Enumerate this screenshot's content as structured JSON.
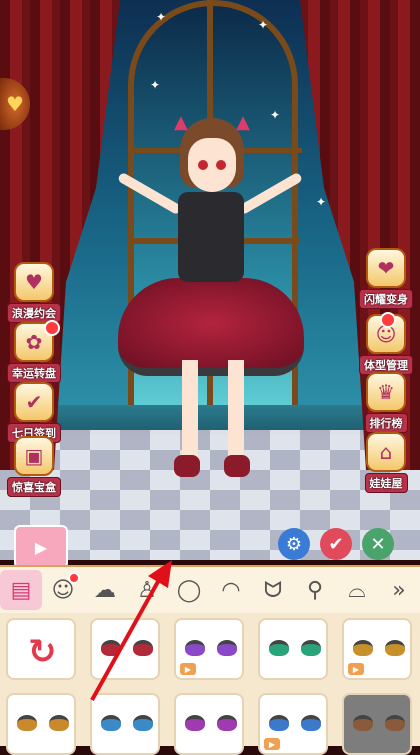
{
  "side_left": [
    {
      "label": "浪漫约会",
      "icon": "date-icon"
    },
    {
      "label": "幸运转盘",
      "icon": "wheel-icon"
    },
    {
      "label": "七日签到",
      "icon": "checkin-icon"
    },
    {
      "label": "惊喜宝盒",
      "icon": "box-icon"
    }
  ],
  "side_right": [
    {
      "label": "闪耀变身",
      "icon": "heart-icon"
    },
    {
      "label": "体型管理",
      "icon": "body-icon"
    },
    {
      "label": "排行榜",
      "icon": "rank-icon"
    },
    {
      "label": "娃娃屋",
      "icon": "house-icon"
    }
  ],
  "categories": [
    "wardrobe-icon",
    "face-icon",
    "hair-icon",
    "top-icon",
    "shoes-icon",
    "faceshape-icon",
    "eyebrow-icon",
    "ears-icon",
    "earrings-icon",
    "glasses-icon"
  ],
  "colors": {
    "accent": "#d63a72",
    "confirm": "#e04a5a",
    "cancel": "#4aa36a",
    "settings": "#3a7bd5",
    "arrow": "#e0101a"
  },
  "eye_colors": [
    "#b12a3a",
    "#8a4ac8",
    "#2aa37a",
    "#c8902a",
    "#b0b0b0",
    "#c88a2a",
    "#3a8ac8",
    "#a03ab0",
    "#3a7ac8",
    "#8a5a3a"
  ]
}
